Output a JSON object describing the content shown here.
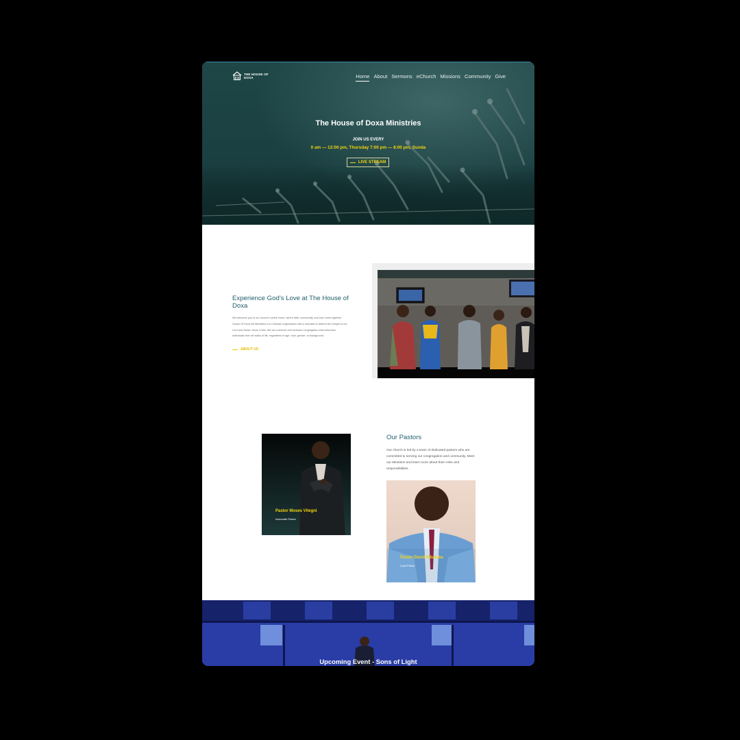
{
  "site": {
    "logo_text": "THE HOUSE OF DOXA",
    "logo_icon": "church-house-icon"
  },
  "nav": {
    "items": [
      "Home",
      "About",
      "Sermons",
      "eChurch",
      "Missions",
      "Community",
      "Give"
    ],
    "active": "Home"
  },
  "hero": {
    "title": "The House of Doxa Ministries",
    "join": "JOIN US EVERY",
    "times": "0 am — 12:00 pm, Thursday 7:00 pm — 8:00 pm, Sunda",
    "button": "LIVE STREAM"
  },
  "about": {
    "title": "Experience God’s Love at The House of Doxa",
    "body": "We welcome you to our church's online home, where faith, community, and love come together. House Of Doxa Intl Ministries is a Christian organization with a mandate to defend the Gospel of our Lord and Savior Jesus Christ. We are a diverse and inclusive congregation that welcomes individuals from all walks of life, regardless of age, race, gender, or background.",
    "link": "ABOUT US"
  },
  "pastors": {
    "title": "Our Pastors",
    "body": "Our church is led by a team of dedicated pastors who are committed to serving our congregation and community. Meet our Ministers and learn more about their roles and responsibilities.",
    "cards": [
      {
        "name": "Pastor Moses Vitegni",
        "role": "Associate Pastor"
      },
      {
        "name": "Pastor David Mbamba",
        "role": "Lead Pastor"
      }
    ]
  },
  "event": {
    "title": "Upcoming Event - Sons of Light"
  },
  "colors": {
    "hero_teal": "#1b4142",
    "accent_yellow": "#f5d50e",
    "heading_teal": "#1d5d6a",
    "event_blue": "#25389a"
  }
}
